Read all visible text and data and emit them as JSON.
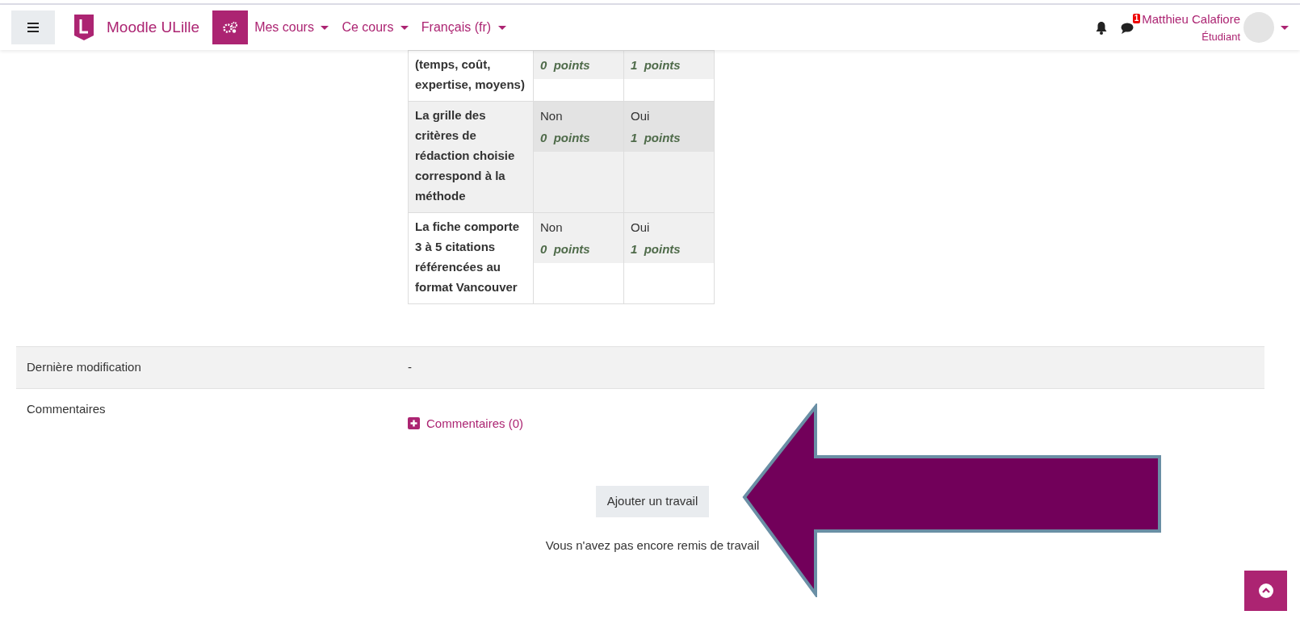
{
  "navbar": {
    "brand": "Moodle ULille",
    "menus": [
      {
        "label": "Mes cours"
      },
      {
        "label": "Ce cours"
      },
      {
        "label": "Français (fr)"
      }
    ],
    "messages_badge": "1",
    "user": {
      "name": "Matthieu Calafiore",
      "role": "Étudiant"
    }
  },
  "rubric": {
    "rows": [
      {
        "criterion": "(temps, coût, expertise, moyens)",
        "levels": [
          {
            "points": "0  points"
          },
          {
            "points": "1  points"
          }
        ]
      },
      {
        "criterion": "La grille des critères de rédaction choisie correspond à la méthode",
        "levels": [
          {
            "label": "Non",
            "points": "0  points"
          },
          {
            "label": "Oui",
            "points": "1  points"
          }
        ]
      },
      {
        "criterion": "La fiche comporte 3 à 5 citations référencées au format Vancouver",
        "levels": [
          {
            "label": "Non",
            "points": "0  points"
          },
          {
            "label": "Oui",
            "points": "1  points"
          }
        ]
      }
    ]
  },
  "status": [
    {
      "label": "Dernière modification",
      "value": "-"
    },
    {
      "label": "Commentaires",
      "link": "Commentaires (0)"
    }
  ],
  "submit_button": "Ajouter un travail",
  "submission_note": "Vous n'avez pas encore remis de travail"
}
